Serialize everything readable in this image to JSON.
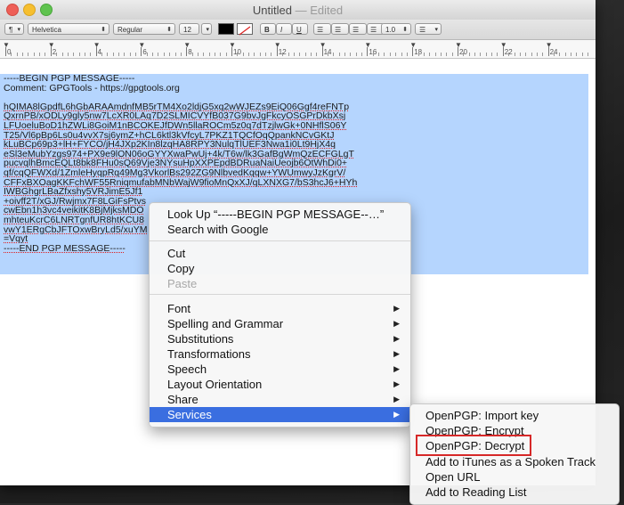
{
  "window": {
    "title": "Untitled",
    "title_sep": " — ",
    "edited": "Edited"
  },
  "toolbar": {
    "style_popup": "¶",
    "font_family": "Helvetica",
    "font_style": "Regular",
    "font_size": "12",
    "bold": "B",
    "italic": "I",
    "underline": "U",
    "line_spacing": "1.0",
    "text_color": "#000000",
    "highlight_color": "#ffffff"
  },
  "ruler": {
    "labels": [
      "0",
      "2",
      "4",
      "6",
      "8",
      "10",
      "12",
      "14",
      "16",
      "18",
      "20",
      "22",
      "24"
    ]
  },
  "document": {
    "lines": [
      "-----BEGIN PGP MESSAGE-----",
      "Comment: GPGTools - https://gpgtools.org",
      "",
      "hQIMA8lGpdfL6hGbARAAmdnfMB5rTM4Xo2ldjG5xq2wWJEZs9EiQ06Ggf4reFNTp",
      "QxrnPB/xODLy9gly5nw7LcXR0LAq7D2SLMICVYfB037G9bvJgFkcyOSGPrDkbXsj",
      "LFUoeluBoD1hZWLi8GoiM1nBCOKEJfDWn5llaROCm5z0q7dTzjlwGk+0NHflS06Y",
      "T25/Vl6pBp6Ls0u4vvX7sj6ymZ+hCL6ktl3kVfcyL7PKZ1TQCfOqQpankNCvGKtJ",
      "kLuBCp69p3+lH+FYCO/jH4JXp2KIn8lzqHA8RPY3NulqTlUEF3Nwa1i0Lt9HjX4q",
      "eSl3eMubYzgs974+PX9e9lON06oGYYXwaPwUj+4k/T6w/lk3GafBgWmQzECFGLgT",
      "pucvqlhBmcEQLt8bk8FHu0sQ69Vje3NYsuHpXXPEpdBDRuaNaiUeojb6OtWhDi0+",
      "qf/cqQFWXd/1ZmleHyqpRq49Mg3VkorlBs292ZG9NlbvedKqqw+YWUmwyJzKgrV/",
      "CFFxBXOagKKFchWF55RniqmufabMNbWajW9fioMnQxXJ/qLXNXG7/bS3hcJ6+HYh",
      "IWBGhgrLBaZfxshy5VRJimE5Jf1",
      "+oivff2T/xGJ/Rwjmx7F8LGiFsPtvs",
      "cwEbn1h3vc4veikitK8BjMjksMDO",
      "mhteuKcrC6LNRTgnfUR8htKCU8",
      "vwY1ERgCbJFTOxwBryLd5/xuYM",
      "=Vqyt",
      "-----END PGP MESSAGE-----"
    ]
  },
  "context_menu": {
    "items": [
      {
        "label": "Look Up “-----BEGIN PGP MESSAGE--…”",
        "submenu": false,
        "enabled": true
      },
      {
        "label": "Search with Google",
        "submenu": false,
        "enabled": true
      },
      {
        "label": "Cut",
        "submenu": false,
        "enabled": true
      },
      {
        "label": "Copy",
        "submenu": false,
        "enabled": true
      },
      {
        "label": "Paste",
        "submenu": false,
        "enabled": false
      },
      {
        "label": "Font",
        "submenu": true,
        "enabled": true
      },
      {
        "label": "Spelling and Grammar",
        "submenu": true,
        "enabled": true
      },
      {
        "label": "Substitutions",
        "submenu": true,
        "enabled": true
      },
      {
        "label": "Transformations",
        "submenu": true,
        "enabled": true
      },
      {
        "label": "Speech",
        "submenu": true,
        "enabled": true
      },
      {
        "label": "Layout Orientation",
        "submenu": true,
        "enabled": true
      },
      {
        "label": "Share",
        "submenu": true,
        "enabled": true
      },
      {
        "label": "Services",
        "submenu": true,
        "enabled": true,
        "active": true
      }
    ]
  },
  "services_submenu": {
    "items": [
      "OpenPGP: Import key",
      "OpenPGP: Encrypt",
      "OpenPGP: Decrypt",
      "Add to iTunes as a Spoken Track",
      "Open URL",
      "Add to Reading List"
    ],
    "highlighted": "OpenPGP: Decrypt",
    "highlight_color": "#d62828"
  },
  "colors": {
    "selection": "#b5d5fe",
    "menu_active": "#3a6ee0"
  }
}
